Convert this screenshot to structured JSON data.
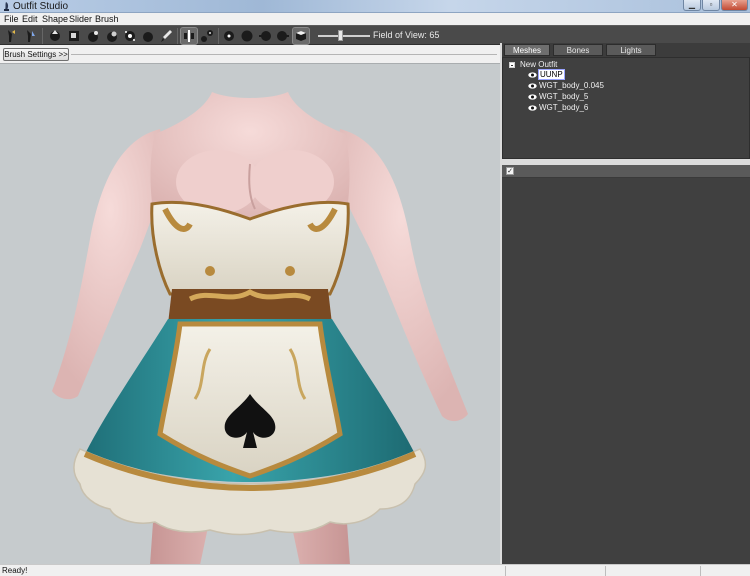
{
  "window": {
    "title": "Outfit Studio"
  },
  "menu": [
    "File",
    "Edit",
    "Shape",
    "Slider",
    "Brush"
  ],
  "toolbar": {
    "buttons": [
      "move-tool-icon",
      "inflate-brush-icon",
      "deflate-brush-icon",
      "smooth-brush-icon",
      "mask-brush-icon",
      "unmask-brush-icon",
      "sphere-brush-icon",
      "half-sphere-icon",
      "weight-brush-icon",
      "vertex-color-brush-icon",
      "symmetry-toggle-icon",
      "gizmo-icon",
      "view-front-icon",
      "view-side-icon",
      "view-left-icon",
      "view-right-icon",
      "view-perspective-icon"
    ],
    "fov_label": "Field of View: 65",
    "field_of_view": 65
  },
  "brush_settings": {
    "label": "Brush Settings >>"
  },
  "tabs": [
    {
      "label": "Meshes",
      "active": true
    },
    {
      "label": "Bones",
      "active": false
    },
    {
      "label": "Lights",
      "active": false
    }
  ],
  "mesh_tree": {
    "root": "New Outfit",
    "items": [
      {
        "label": "UUNP",
        "selected": true
      },
      {
        "label": "WGT_body_0.045",
        "selected": false
      },
      {
        "label": "WGT_body_5",
        "selected": false
      },
      {
        "label": "WGT_body_6",
        "selected": false
      }
    ]
  },
  "slider_panel": {
    "checkbox_state": "✓"
  },
  "status": {
    "text": "Ready!"
  },
  "colors": {
    "toolbar_bg": "#4a4a4a",
    "panel_bg": "#404040",
    "viewport_bg": "#c6cbcd",
    "skin": "#ecc8c6",
    "dress_teal": "#2a8f96",
    "gold_trim": "#b88a3e",
    "apron_cream": "#ebe6d8"
  }
}
